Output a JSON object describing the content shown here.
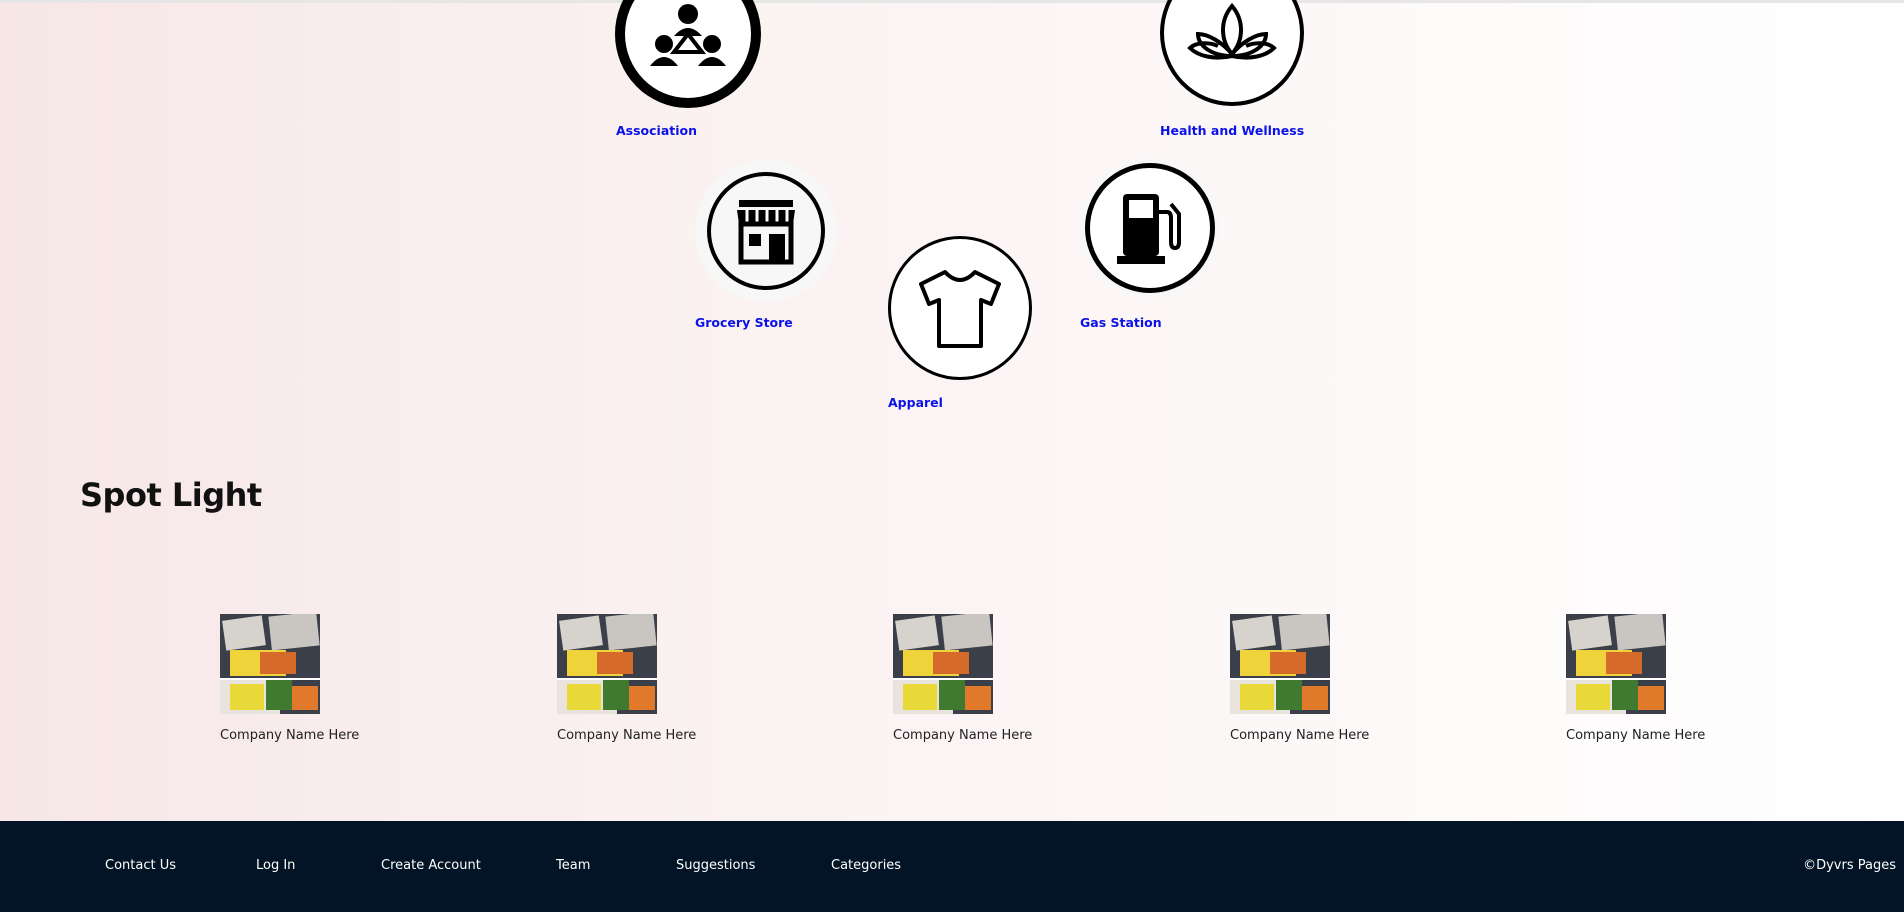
{
  "categories": [
    {
      "label": "Association",
      "icon": "association-icon"
    },
    {
      "label": "Health and Wellness",
      "icon": "lotus-icon"
    },
    {
      "label": "Grocery Store",
      "icon": "storefront-icon"
    },
    {
      "label": "Gas Station",
      "icon": "gas-pump-icon"
    },
    {
      "label": "Apparel",
      "icon": "tshirt-icon"
    }
  ],
  "spotlight": {
    "title": "Spot Light",
    "companies": [
      {
        "name": "Company Name Here"
      },
      {
        "name": "Company Name Here"
      },
      {
        "name": "Company Name Here"
      },
      {
        "name": "Company Name Here"
      },
      {
        "name": "Company Name Here"
      }
    ]
  },
  "footer": {
    "links": [
      "Contact Us",
      "Log In",
      "Create Account",
      "Team",
      "Suggestions",
      "Categories"
    ],
    "copyright": "©Dyvrs Pages"
  }
}
